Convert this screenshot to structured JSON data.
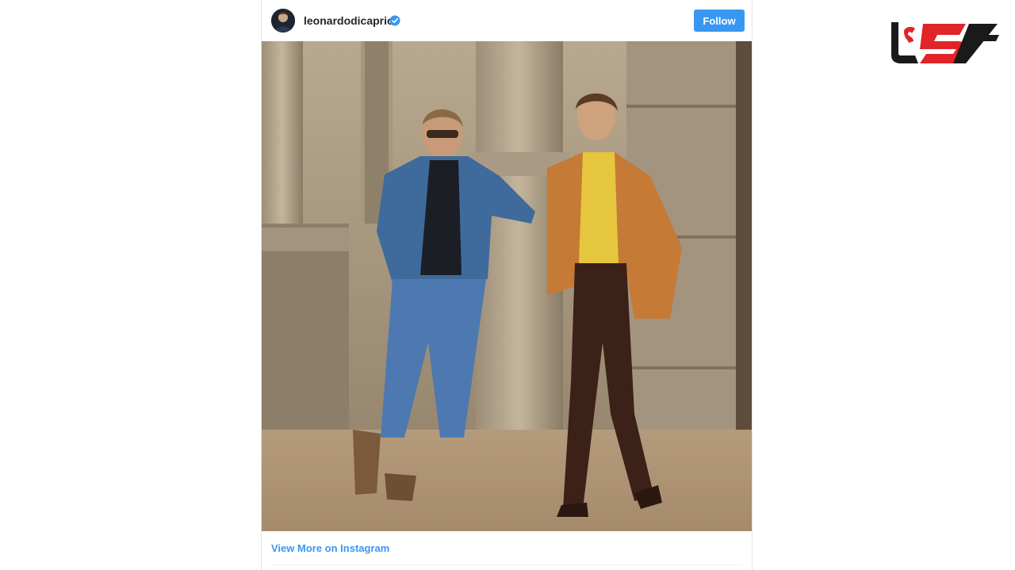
{
  "post": {
    "username": "leonardodicaprio",
    "verified_icon": "verified-badge-icon",
    "follow_label": "Follow",
    "view_more_label": "View More on Instagram",
    "photo_subject": "two men posing against stone columns"
  },
  "site_logo": {
    "text": "ل5"
  },
  "colors": {
    "accent": "#3897f0",
    "logo_red": "#e0242a",
    "logo_black": "#1a1a1a"
  }
}
